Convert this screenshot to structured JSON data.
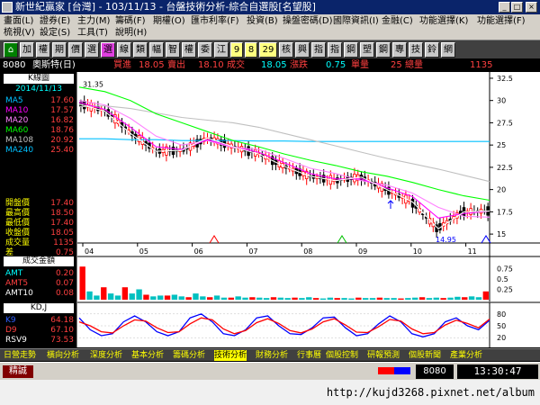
{
  "window": {
    "title": "新世紀贏家 [台灣] - 103/11/13 - 台盤技術分析-綜合自選股[名望股]",
    "btn_min": "_",
    "btn_max": "□",
    "btn_close": "×"
  },
  "menu": {
    "items": [
      "畫面(L)",
      "證券(E)",
      "主力(M)",
      "籌碼(F)",
      "期權(O)",
      "匯市利率(F)",
      "投資(B)",
      "操盤密碼(D)",
      "國際資訊(I)",
      "金融(C)",
      "功能選擇(K)",
      "功能選擇(F)",
      "梳視(V)",
      "設定(S)",
      "工具(T)",
      "說明(H)"
    ]
  },
  "toolbar": {
    "buttons": [
      "加",
      "權",
      "期",
      "價",
      "選",
      "選",
      "線",
      "類",
      "幅",
      "智",
      "權",
      "委",
      "江",
      "9",
      "8",
      "29",
      "核",
      "興",
      "指",
      "指",
      "鋼",
      "塑",
      "鋼",
      "專",
      "技",
      "鈴",
      "網"
    ]
  },
  "quote": {
    "code": "8080",
    "name": "奧斯特(日)",
    "buy_label": "買進",
    "buy_value": "18.05",
    "sell_label": "賣出",
    "sell_value": "18.10",
    "deal_label": "成交",
    "deal_value": "18.05",
    "change_label": "漲跌",
    "change_value": "0.75",
    "unit_label": "單量",
    "unit_value": "25",
    "total_label": "總量",
    "total_value": "1135"
  },
  "left_panel": {
    "kline_label": "K線圖",
    "date": "2014/11/13",
    "ma": [
      {
        "name": "MA5",
        "value": "17.60",
        "color": "#00c0ff"
      },
      {
        "name": "MA10",
        "value": "17.57",
        "color": "#ff00ff"
      },
      {
        "name": "MA20",
        "value": "16.82",
        "color": "#ff80ff"
      },
      {
        "name": "MA60",
        "value": "18.76",
        "color": "#00ff00"
      },
      {
        "name": "MA108",
        "value": "20.92",
        "color": "#c0c0c0"
      },
      {
        "name": "MA240",
        "value": "25.40",
        "color": "#00c0ff"
      }
    ],
    "prices": [
      {
        "name": "開盤價",
        "value": "17.40"
      },
      {
        "name": "最高價",
        "value": "18.50"
      },
      {
        "name": "最低價",
        "value": "17.40"
      },
      {
        "name": "收盤價",
        "value": "18.05"
      },
      {
        "name": "成交量",
        "value": "1135"
      },
      {
        "name": "差",
        "value": "0.75"
      }
    ],
    "vol_label": "成交金額",
    "amt": [
      {
        "name": "AMT",
        "value": "0.20",
        "color": "#00ffff"
      },
      {
        "name": "AMT5",
        "value": "0.07",
        "color": "#ff0000"
      },
      {
        "name": "AMT10",
        "value": "0.08",
        "color": "#ffffff"
      }
    ],
    "kd_label": "KD,J",
    "kd": [
      {
        "name": "K9",
        "value": "64.18",
        "color": "#3060ff"
      },
      {
        "name": "D9",
        "value": "67.10",
        "color": "#ff0000"
      },
      {
        "name": "RSV9",
        "value": "73.53",
        "color": "#ffffff"
      }
    ]
  },
  "chart_data": {
    "type": "line",
    "months": [
      "04",
      "05",
      "06",
      "07",
      "08",
      "09",
      "10",
      "11"
    ],
    "y_ticks": [
      "32.5",
      "30",
      "27.5",
      "25",
      "22.5",
      "20",
      "17.5",
      "15"
    ],
    "ylim": [
      14,
      33
    ],
    "high_label": "31.35",
    "low_label": "14.95",
    "vol_ticks": [
      "0.75",
      "0.5",
      "0.25"
    ],
    "kd_ticks": [
      "80",
      "50",
      "20"
    ],
    "series": [
      {
        "name": "MA240",
        "color": "#00c0ff",
        "values": [
          25.7,
          25.7,
          25.6,
          25.6,
          25.5,
          25.5,
          25.5,
          25.45,
          25.45,
          25.4,
          25.4,
          25.4,
          25.4,
          25.4,
          25.4,
          25.4,
          25.4
        ]
      },
      {
        "name": "MA108",
        "color": "#c0c0c0",
        "values": [
          29.3,
          29.4,
          29.1,
          28.6,
          28.1,
          27.8,
          27.5,
          27.0,
          26.3,
          25.6,
          24.9,
          24.2,
          23.5,
          22.9,
          22.3,
          21.6,
          20.9
        ]
      },
      {
        "name": "MA60",
        "color": "#00ff00",
        "values": [
          31.5,
          31.0,
          30.0,
          28.5,
          27.5,
          26.5,
          25.5,
          24.8,
          24.0,
          23.3,
          22.7,
          22.0,
          21.5,
          20.8,
          20.0,
          19.3,
          18.8
        ]
      },
      {
        "name": "MA20",
        "color": "#ff80ff",
        "values": [
          30.0,
          29.5,
          28.0,
          26.0,
          25.0,
          25.5,
          24.7,
          24.5,
          23.5,
          22.4,
          21.8,
          21.0,
          20.5,
          19.6,
          18.0,
          17.0,
          16.9
        ]
      },
      {
        "name": "MA10",
        "color": "#ff00ff",
        "values": [
          29.8,
          29.0,
          27.0,
          24.8,
          24.5,
          25.6,
          24.8,
          24.2,
          23.0,
          21.8,
          21.2,
          21.2,
          20.2,
          19.2,
          16.8,
          17.3,
          17.6
        ]
      },
      {
        "name": "MA5",
        "color": "#ffffff",
        "values": [
          29.6,
          28.8,
          26.3,
          24.3,
          24.4,
          25.8,
          24.8,
          24.0,
          22.6,
          21.5,
          21.0,
          21.4,
          20.0,
          18.6,
          15.6,
          17.5,
          17.6
        ]
      }
    ],
    "amt_values": [
      0.8,
      0.2,
      0.1,
      0.3,
      0.15,
      0.1,
      0.3,
      0.15,
      0.25,
      0.12,
      0.08,
      0.1,
      0.1,
      0.12,
      0.08,
      0.06,
      0.15,
      0.08,
      0.06,
      0.1,
      0.05,
      0.05,
      0.08,
      0.05,
      0.06,
      0.05,
      0.04,
      0.06,
      0.05,
      0.04,
      0.05,
      0.04,
      0.06,
      0.04,
      0.03,
      0.05,
      0.04,
      0.04,
      0.03,
      0.05,
      0.04,
      0.04,
      0.05,
      0.04,
      0.04,
      0.03,
      0.04,
      0.05,
      0.06,
      0.04,
      0.05,
      0.04,
      0.05,
      0.07,
      0.06,
      0.08,
      0.06,
      0.2
    ],
    "kd_k": [
      70,
      40,
      25,
      30,
      60,
      75,
      60,
      35,
      25,
      35,
      70,
      80,
      60,
      30,
      25,
      40,
      70,
      75,
      50,
      30,
      28,
      45,
      70,
      72,
      45,
      25,
      30,
      55,
      75,
      60,
      30,
      22,
      30,
      60,
      70,
      50,
      40,
      64
    ],
    "kd_d": [
      60,
      50,
      35,
      32,
      50,
      65,
      62,
      45,
      33,
      35,
      55,
      70,
      65,
      42,
      30,
      38,
      58,
      68,
      56,
      38,
      32,
      42,
      60,
      68,
      52,
      34,
      33,
      48,
      66,
      62,
      42,
      30,
      33,
      52,
      64,
      56,
      45,
      67
    ]
  },
  "tabs": [
    "日營走勢",
    "橫向分析",
    "深度分析",
    "基本分析",
    "籌碼分析",
    "技術分析",
    "財務分析",
    "行事曆",
    "個股控制",
    "研報預測",
    "個股新聞",
    "產業分析"
  ],
  "status": {
    "left_label": "精誠",
    "code": "8080",
    "clock": "13:30:47"
  },
  "watermark": "http://kujd3268.pixnet.net/album"
}
